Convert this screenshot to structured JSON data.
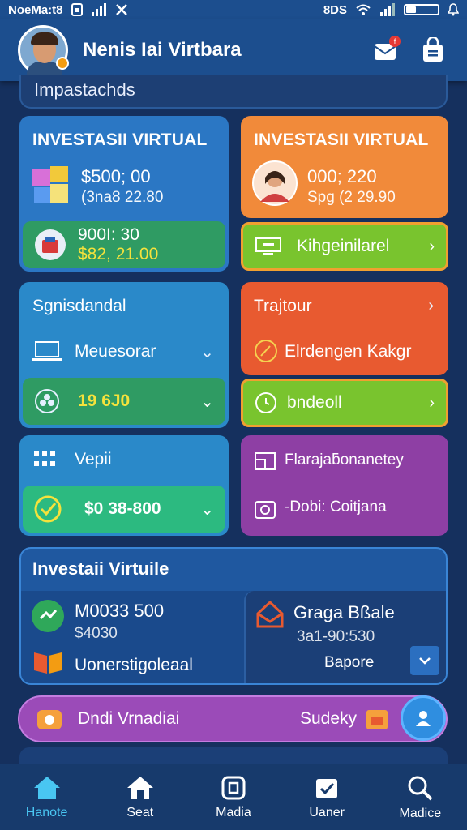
{
  "status_bar": {
    "carrier": "NoeMa:t8",
    "right_text": "8DS"
  },
  "header": {
    "title": "Nenis Iai Virtbara",
    "notification_count": "f"
  },
  "section_label": "Impastachds",
  "card_investasi_1": {
    "title": "INVESTASII VIRTUAL",
    "amount": "$500; 00",
    "sub_amount": "(3na8 22.80",
    "row_value": "900I: 30",
    "row_subvalue": "$82, 21.00"
  },
  "card_investasi_2": {
    "title": "INVESTASII VIRTUAL",
    "amount": "000; 220",
    "sub_amount": "Spg (2 29.90",
    "row_label": "Kihgeinilarel"
  },
  "card_sponsor": {
    "title": "Sgnisdandal",
    "row_label": "Meuesorar",
    "row_value": "19 6J0"
  },
  "card_trajtour": {
    "title": "Trajtour",
    "row_label": "Elrdengen Kakgr",
    "row_label2": "bndeoll"
  },
  "card_vepii": {
    "title": "Vepii",
    "row_value": "$0 38-800"
  },
  "card_purple": {
    "row1": "Flarajaƃonanetey",
    "row2": "-Dobi: Coitjana"
  },
  "investasi_panel": {
    "title": "Investaii Virtuile",
    "left_value": "M0033 500",
    "left_sub": "$4030",
    "left_label": "Uonerstigoleaal",
    "right_title": "Graga Bßale",
    "right_sub": "3a1-90:530",
    "right_button": "Bapore"
  },
  "pill_bar": {
    "left": "Dndi Vrnadiai",
    "right": "Sudeky"
  },
  "bottom_nav": [
    {
      "label": "Hanote",
      "icon": "home-icon"
    },
    {
      "label": "Seat",
      "icon": "home-outline-icon"
    },
    {
      "label": "Madia",
      "icon": "square-icon"
    },
    {
      "label": "Uaner",
      "icon": "check-icon"
    },
    {
      "label": "Madice",
      "icon": "person-search-icon"
    }
  ]
}
